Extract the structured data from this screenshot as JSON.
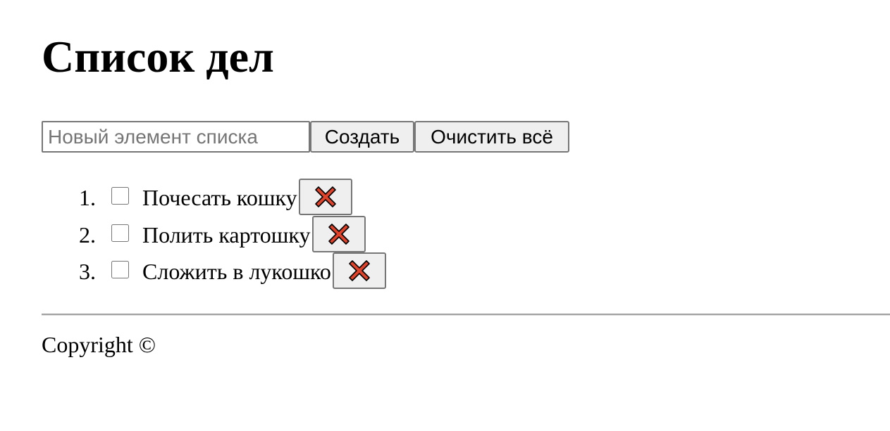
{
  "title": "Список дел",
  "form": {
    "input_placeholder": "Новый элемент списка",
    "input_value": "",
    "create_label": "Создать",
    "clear_all_label": "Очистить всё"
  },
  "items": [
    {
      "number": "1.",
      "text": "Почесать кошку",
      "checked": false,
      "delete_icon": "cross-mark-icon"
    },
    {
      "number": "2.",
      "text": "Полить картошку",
      "checked": false,
      "delete_icon": "cross-mark-icon"
    },
    {
      "number": "3.",
      "text": "Сложить в лукошко",
      "checked": false,
      "delete_icon": "cross-mark-icon"
    }
  ],
  "footer": {
    "copyright": "Copyright ©"
  },
  "colors": {
    "delete_icon_fill": "#e0432b",
    "delete_icon_stroke": "#000000"
  }
}
